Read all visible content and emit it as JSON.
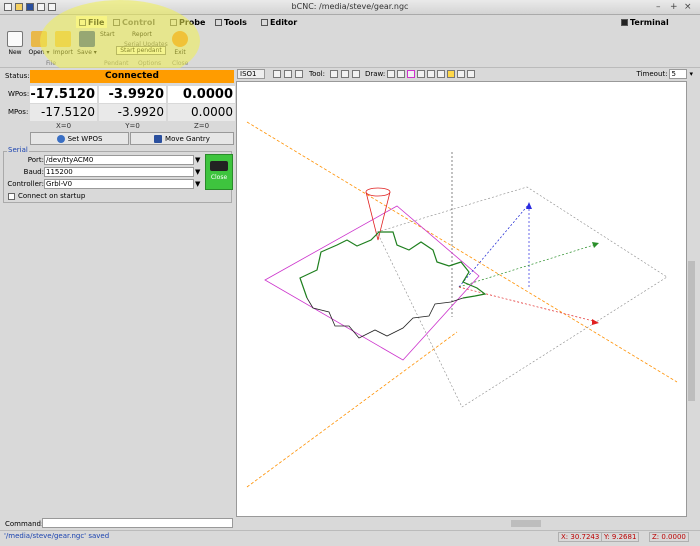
{
  "window": {
    "title": "bCNC: /media/steve/gear.ngc"
  },
  "menu": {
    "tabs": [
      {
        "label": "File"
      },
      {
        "label": "Control"
      },
      {
        "label": "Probe"
      },
      {
        "label": "Tools"
      },
      {
        "label": "Editor"
      }
    ],
    "terminal_label": "Terminal"
  },
  "ribbon": {
    "new_label": "New",
    "open_label": "Open ▾",
    "import_label": "Import",
    "save_label": "Save ▾",
    "start_label": "Start",
    "report_label": "Report",
    "serial_updates_label": "Serial Updates",
    "start_pendant_label": "Start pendant",
    "exit_label": "Exit",
    "groups": {
      "file": "File",
      "pendant": "Pendant",
      "options": "Options",
      "close": "Close"
    }
  },
  "status": {
    "label": "Status:",
    "value": "Connected"
  },
  "position": {
    "wpos_label": "WPos:",
    "mpos_label": "MPos:",
    "wpos": [
      "-17.5120",
      "-3.9920",
      "0.0000"
    ],
    "mpos": [
      "-17.5120",
      "-3.9920",
      "0.0000"
    ],
    "axes": [
      "X=0",
      "Y=0",
      "Z=0"
    ],
    "set_wpos_label": "Set WPOS",
    "move_gantry_label": "Move Gantry"
  },
  "serial": {
    "caption": "Serial",
    "port_label": "Port:",
    "port_value": "/dev/ttyACM0",
    "baud_label": "Baud:",
    "baud_value": "115200",
    "controller_label": "Controller:",
    "controller_value": "Grbl-V0",
    "close_label": "Close",
    "connect_startup_label": "Connect on startup"
  },
  "viewer": {
    "view_select": "ISO1",
    "tool_label": "Tool:",
    "draw_label": "Draw:",
    "timeout_label": "Timeout:",
    "timeout_value": "5"
  },
  "command": {
    "label": "Command:"
  },
  "statusbar": {
    "message": "'/media/steve/gear.ngc' saved",
    "x": "X: 30.7243",
    "y": "Y: 9.2681",
    "z": "Z: 0.0000"
  },
  "colors": {
    "connected": "#ff9c00",
    "gear": "#1e7f1e",
    "stock": "#cc33cc",
    "axis_x": "#e02020",
    "axis_y": "#2a8f2a",
    "axis_z": "#2a2ae0",
    "xline": "#ff9000"
  }
}
